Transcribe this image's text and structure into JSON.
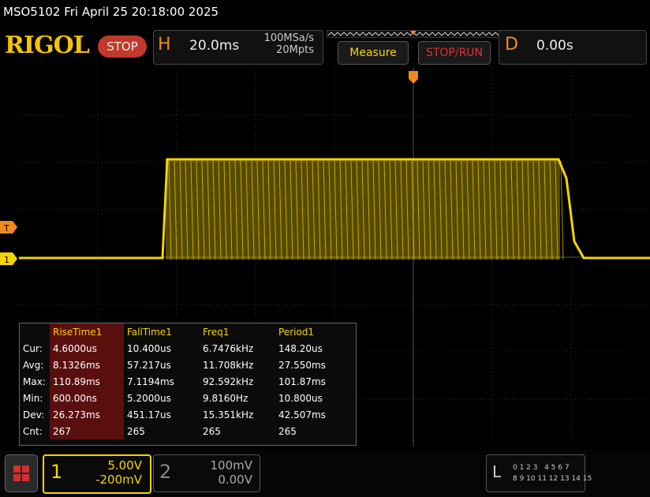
{
  "header": {
    "model_datetime": "MSO5102  Fri April 25 20:18:00 2025",
    "logo": "RIGOL",
    "run_state": "STOP",
    "horizontal": {
      "letter": "H",
      "scale": "20.0ms",
      "sample_rate": "100MSa/s",
      "memory_depth": "20Mpts"
    },
    "measure_label": "Measure",
    "stop_run_label": "STOP/RUN",
    "delay": {
      "letter": "D",
      "value": "0.00s"
    }
  },
  "markers": {
    "trigger_level": "T",
    "channel1": "1"
  },
  "measurements": {
    "columns": [
      "",
      "RiseTime1",
      "FallTime1",
      "Freq1",
      "Period1"
    ],
    "rows": [
      {
        "label": "Cur:",
        "values": [
          "4.6000us",
          "10.400us",
          "6.7476kHz",
          "148.20us"
        ]
      },
      {
        "label": "Avg:",
        "values": [
          "8.1326ms",
          "57.217us",
          "11.708kHz",
          "27.550ms"
        ]
      },
      {
        "label": "Max:",
        "values": [
          "110.89ms",
          "7.1194ms",
          "92.592kHz",
          "101.87ms"
        ]
      },
      {
        "label": "Min:",
        "values": [
          "600.00ns",
          "5.2000us",
          "9.8160Hz",
          "10.800us"
        ]
      },
      {
        "label": "Dev:",
        "values": [
          "26.273ms",
          "451.17us",
          "15.351kHz",
          "42.507ms"
        ]
      },
      {
        "label": "Cnt:",
        "values": [
          "267",
          "265",
          "265",
          "265"
        ]
      }
    ]
  },
  "channels": {
    "ch1": {
      "number": "1",
      "scale": "5.00V",
      "offset": "-200mV"
    },
    "ch2": {
      "number": "2",
      "scale": "100mV",
      "offset": "0.00V"
    }
  },
  "logic": {
    "letter": "L",
    "row1": "0 1 2 3   4 5 6 7",
    "row2": "8 9 10 11 12 13 14 15"
  },
  "colors": {
    "ch1": "#f5d400",
    "accent": "#f08a1c",
    "stop": "#c0392b"
  }
}
